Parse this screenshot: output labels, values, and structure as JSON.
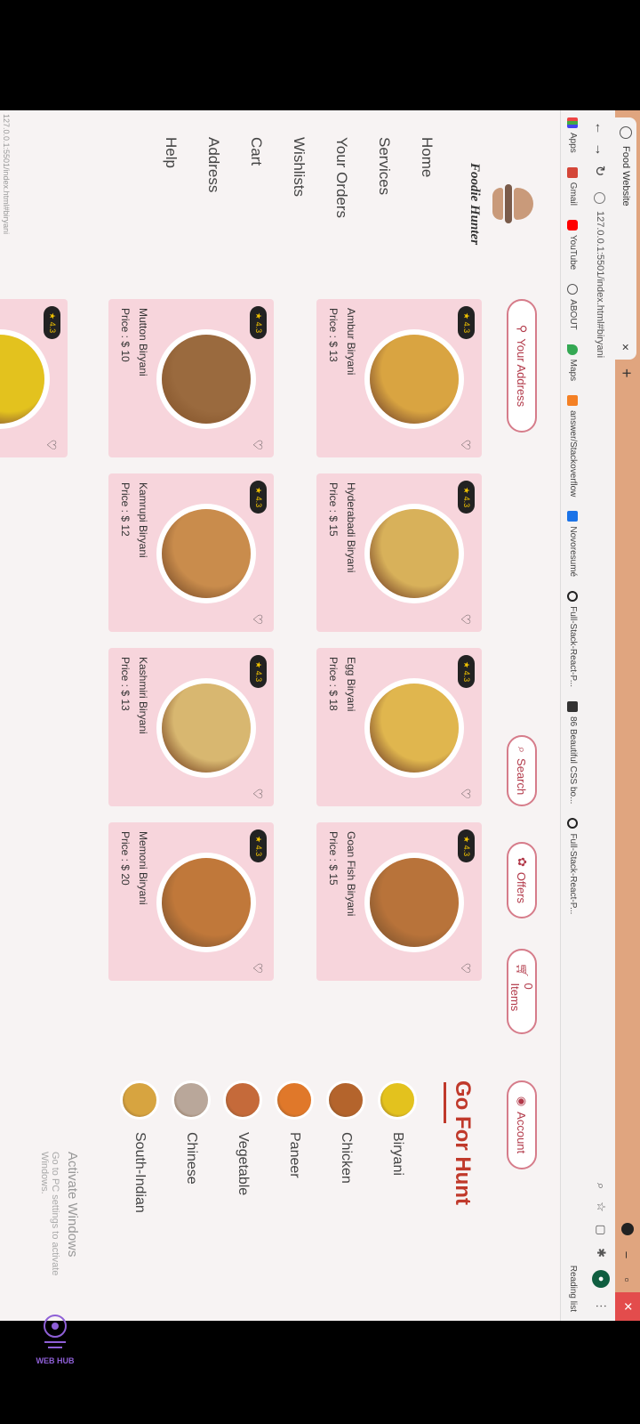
{
  "browser": {
    "tab_title": "Food Website",
    "new_tab": "+",
    "url": "127.0.0.1:5501/index.html#biryani",
    "bookmarks": [
      "Apps",
      "Gmail",
      "YouTube",
      "ABOUT",
      "Maps",
      "answer/Stackoverflow",
      "Novoresumé",
      "Full-Stack-React-P...",
      "86 Beautiful CSS bo...",
      "Full-Stack-React-P..."
    ],
    "reading_list": "Reading list",
    "status_url": "127.0.0.1:5501/index.html#biryani"
  },
  "sidebar": {
    "brand": "Foodie Hunter",
    "nav": [
      "Home",
      "Services",
      "Your Orders",
      "Wishlists",
      "Cart",
      "Address",
      "Help"
    ]
  },
  "header": {
    "address": "Your Address",
    "search": "Search",
    "offers": "Offers",
    "items": "0 Items",
    "account": "Account"
  },
  "cards": [
    {
      "rating": "4.3",
      "name": "Ambur Biryani",
      "price": "Price : $ 13",
      "color": "#d9a441"
    },
    {
      "rating": "4.3",
      "name": "Hyderabadi Biryani",
      "price": "Price : $ 15",
      "color": "#d8b15a"
    },
    {
      "rating": "4.3",
      "name": "Egg Biryani",
      "price": "Price : $ 18",
      "color": "#e0b64e"
    },
    {
      "rating": "4.3",
      "name": "Goan Fish Biryani",
      "price": "Price : $ 15",
      "color": "#b8733a"
    },
    {
      "rating": "4.3",
      "name": "Mutton Biryani",
      "price": "Price : $ 10",
      "color": "#9a6a3e"
    },
    {
      "rating": "4.3",
      "name": "Kamrupi Biryani",
      "price": "Price : $ 12",
      "color": "#c98c4c"
    },
    {
      "rating": "4.3",
      "name": "Kashmiri Biryani",
      "price": "Price : $ 13",
      "color": "#d8b770"
    },
    {
      "rating": "4.3",
      "name": "Memoni Biryani",
      "price": "Price : $ 20",
      "color": "#c0783a"
    },
    {
      "rating": "4.3",
      "name": "",
      "price": "",
      "color": "#e3c21e"
    }
  ],
  "right": {
    "title": "Go For Hunt",
    "categories": [
      {
        "name": "Biryani",
        "color": "#e3c21e"
      },
      {
        "name": "Chicken",
        "color": "#b4642c"
      },
      {
        "name": "Paneer",
        "color": "#e0782a"
      },
      {
        "name": "Vegetable",
        "color": "#c56a3a"
      },
      {
        "name": "Chinese",
        "color": "#b9a79a"
      },
      {
        "name": "South-Indian",
        "color": "#d7a440"
      }
    ]
  },
  "windows": {
    "activate": "Activate Windows",
    "activate_sub": "Go to PC settings to activate Windows."
  },
  "watermark": "WEB HUB"
}
